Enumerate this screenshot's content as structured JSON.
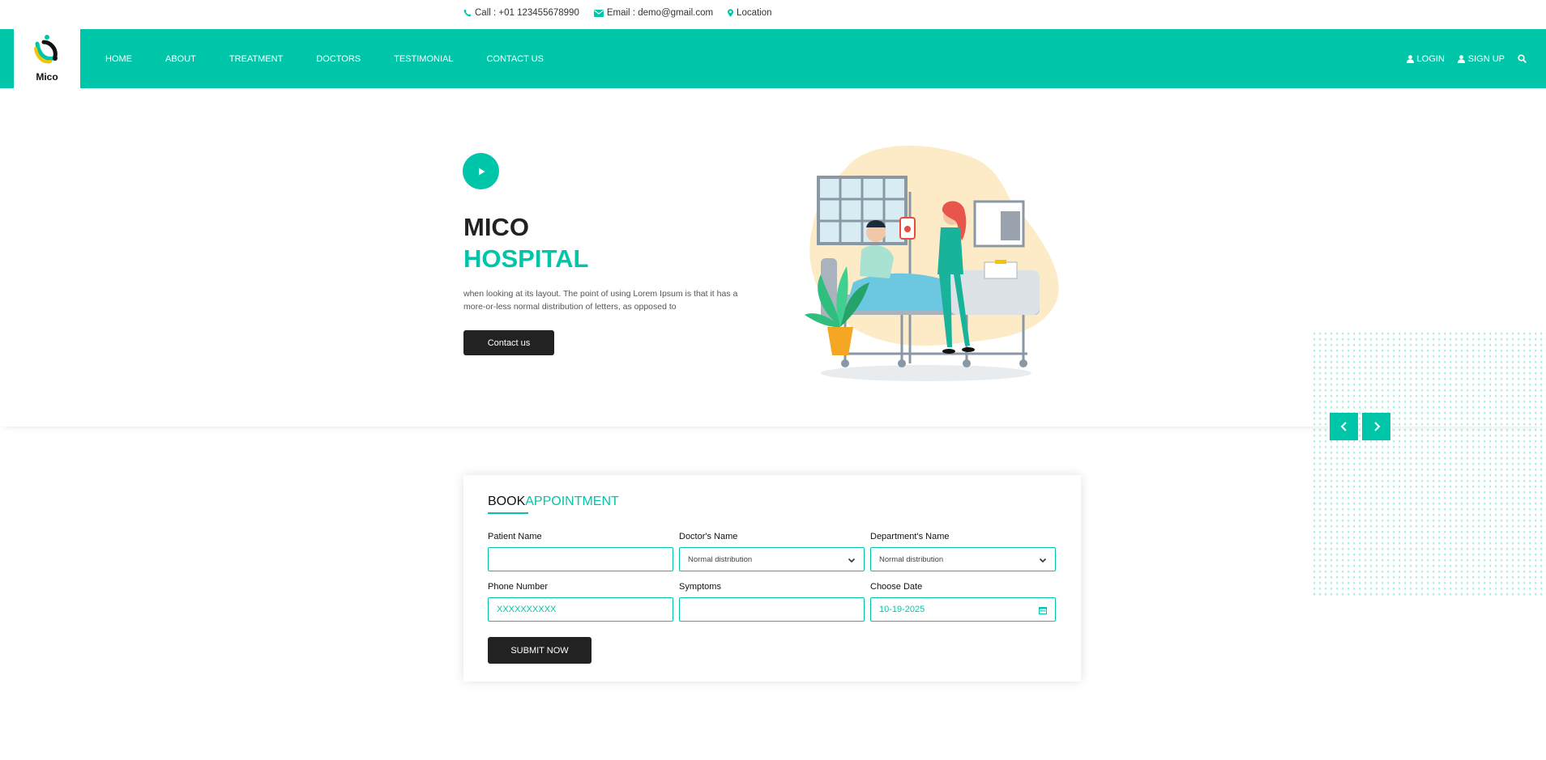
{
  "topbar": {
    "call": "Call : +01 123455678990",
    "email": "Email : demo@gmail.com",
    "location": "Location"
  },
  "brand": {
    "name": "Mico"
  },
  "nav": {
    "items": [
      "HOME",
      "ABOUT",
      "TREATMENT",
      "DOCTORS",
      "TESTIMONIAL",
      "CONTACT US"
    ],
    "login": "LOGIN",
    "signup": "SIGN UP"
  },
  "hero": {
    "title_line1": "MICO",
    "title_line2": "HOSPITAL",
    "description": "when looking at its layout. The point of using Lorem Ipsum is that it has a more-or-less normal distribution of letters, as opposed to",
    "cta": "Contact us"
  },
  "appointment": {
    "title_part1": "BOOK",
    "title_part2": "APPOINTMENT",
    "patient_name_label": "Patient Name",
    "patient_name_value": "",
    "doctor_label": "Doctor's Name",
    "doctor_value": "Normal distribution",
    "department_label": "Department's Name",
    "department_value": "Normal distribution",
    "phone_label": "Phone Number",
    "phone_value": "XXXXXXXXXX",
    "symptoms_label": "Symptoms",
    "symptoms_value": "",
    "date_label": "Choose Date",
    "date_value": "10-19-2025",
    "submit": "SUBMIT NOW"
  },
  "colors": {
    "accent": "#00c6a9",
    "dark": "#222222"
  },
  "icons": [
    "phone-icon",
    "email-icon",
    "location-icon",
    "user-icon",
    "search-icon",
    "play-icon",
    "chevron-left-icon",
    "chevron-right-icon",
    "chevron-down-icon",
    "calendar-icon"
  ]
}
